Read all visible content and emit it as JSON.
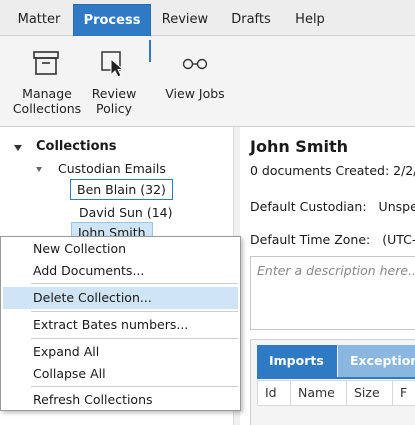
{
  "menu": {
    "tabs": [
      {
        "label": "Matter"
      },
      {
        "label": "Process",
        "active": true
      },
      {
        "label": "Review"
      },
      {
        "label": "Drafts"
      },
      {
        "label": "Help"
      }
    ]
  },
  "ribbon": {
    "manage_collections": {
      "line1": "Manage",
      "line2": "Collections",
      "icon": "archive-box-icon"
    },
    "review_policy": {
      "line1": "Review",
      "line2": "Policy",
      "icon": "cursor-arrow-icon"
    },
    "view_jobs": {
      "label": "View Jobs",
      "icon": "eyeglasses-icon"
    }
  },
  "tree": {
    "root": "Collections",
    "group": "Custodian Emails",
    "items": [
      {
        "label": "Ben Blain (32)"
      },
      {
        "label": "David Sun (14)"
      },
      {
        "label": "John Smith"
      }
    ]
  },
  "detail": {
    "title": "John Smith",
    "summary": "0 documents Created: 2/2/",
    "default_custodian_label": "Default Custodian:",
    "default_custodian_value": "Unspe",
    "default_timezone_label": "Default Time Zone:",
    "default_timezone_value": "(UTC-0",
    "description_placeholder": "Enter a description here...",
    "tabs": [
      {
        "label": "Imports"
      },
      {
        "label": "Exceptions"
      }
    ],
    "columns": [
      "Id",
      "Name",
      "Size",
      "F"
    ]
  },
  "context_menu": {
    "items": [
      "New Collection",
      "Add Documents...",
      "Delete Collection...",
      "Extract Bates numbers...",
      "Expand All",
      "Collapse All",
      "Refresh Collections"
    ],
    "hovered": "Delete Collection..."
  },
  "colors": {
    "accent": "#2f7ac4",
    "selection": "#cfe4f5"
  }
}
